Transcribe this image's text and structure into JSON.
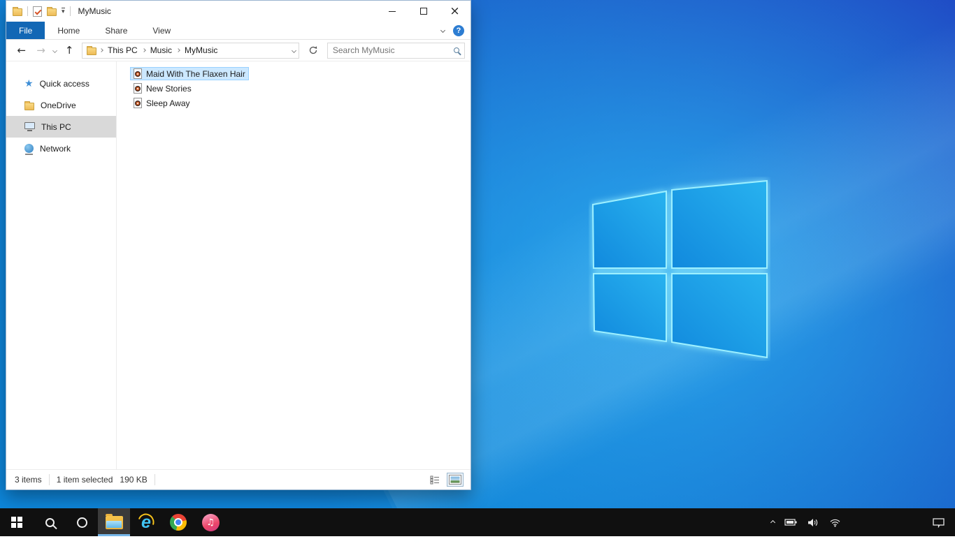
{
  "window": {
    "title": "MyMusic",
    "ribbon": {
      "tabs": [
        "File",
        "Home",
        "Share",
        "View"
      ],
      "active_tab": "File"
    },
    "nav": {
      "breadcrumb": [
        "This PC",
        "Music",
        "MyMusic"
      ]
    },
    "search": {
      "placeholder": "Search MyMusic"
    },
    "sidebar": {
      "items": [
        {
          "label": "Quick access",
          "icon": "quick-access-star-icon",
          "selected": false
        },
        {
          "label": "OneDrive",
          "icon": "onedrive-folder-icon",
          "selected": false
        },
        {
          "label": "This PC",
          "icon": "this-pc-monitor-icon",
          "selected": true
        },
        {
          "label": "Network",
          "icon": "network-globe-icon",
          "selected": false
        }
      ]
    },
    "files": {
      "items": [
        {
          "name": "Maid With The Flaxen Hair",
          "icon": "audio-file-icon",
          "selected": true
        },
        {
          "name": "New Stories",
          "icon": "audio-file-icon",
          "selected": false
        },
        {
          "name": "Sleep Away",
          "icon": "audio-file-icon",
          "selected": false
        }
      ]
    },
    "statusbar": {
      "item_count": "3 items",
      "selection_count": "1 item selected",
      "selection_size": "190 KB"
    }
  },
  "icons": {
    "close": "×",
    "help": "?",
    "back_arrow": "←",
    "forward_arrow": "→",
    "up_arrow": "↑",
    "qat_dropdown": "▾",
    "breadcrumb_chevron": "›",
    "quick_access_star": "★",
    "music_note": "♫",
    "ie_letter": "e"
  },
  "taskbar": {
    "icons": [
      "start",
      "search",
      "cortana",
      "file-explorer",
      "internet-explorer",
      "chrome",
      "itunes"
    ],
    "active_icon": "file-explorer",
    "tray_icons": [
      "hidden-icons-chevron",
      "battery",
      "volume",
      "wifi",
      "action-center"
    ]
  },
  "colors": {
    "file_tab": "#1267b5",
    "help_icon": "#2d7dd2",
    "selection_bg": "#cce8ff",
    "selection_border": "#99d1ff",
    "sidebar_selected_bg": "#d9d9d9",
    "taskbar_bg": "#101010",
    "active_underline": "#77b7e9",
    "wallpaper_dark": "#1f4bc5",
    "wallpaper_bright": "#2db9f5",
    "logo_edge": "#9df0ff"
  }
}
